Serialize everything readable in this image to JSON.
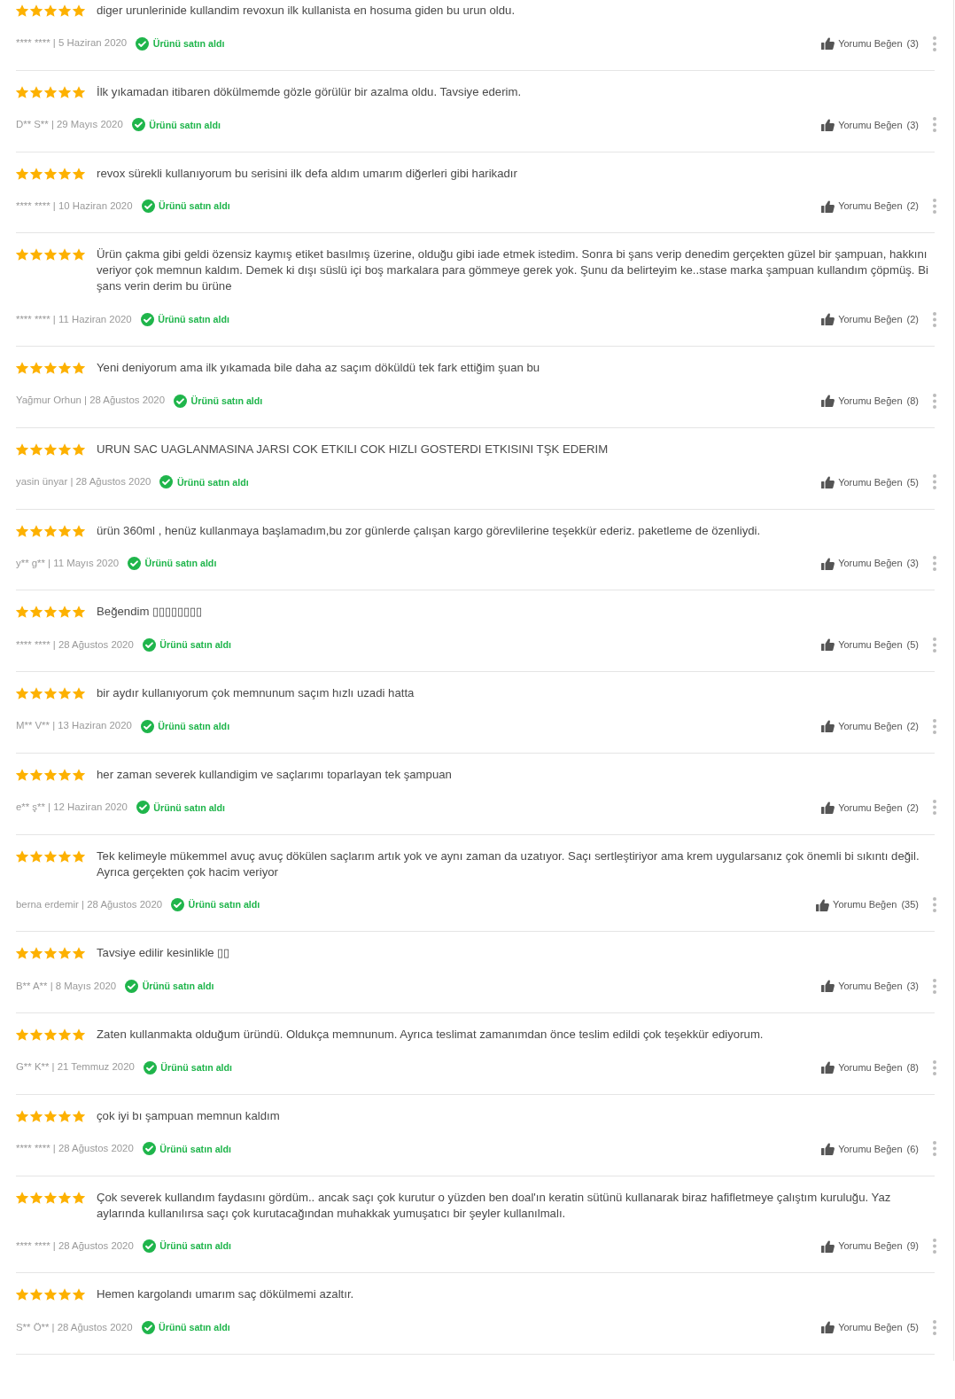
{
  "reviews": [
    {
      "stars": 5,
      "text": "diger urunlerinide kullandim revoxun ilk kullanista en hosuma giden bu urun oldu.",
      "byline": "**** **** | 5 Haziran 2020",
      "verified": true,
      "verified_label": "Ürünü satın aldı",
      "like_label": "Yorumu Beğen",
      "like_count": "(3)"
    },
    {
      "stars": 5,
      "text": "İlk yıkamadan itibaren dökülmemde gözle görülür bir azalma oldu. Tavsiye ederim.",
      "byline": "D** S** | 29 Mayıs 2020",
      "verified": true,
      "verified_label": "Ürünü satın aldı",
      "like_label": "Yorumu Beğen",
      "like_count": "(3)"
    },
    {
      "stars": 5,
      "text": "revox sürekli kullanıyorum bu serisini ilk defa aldım umarım diğerleri gibi harikadır",
      "byline": "**** **** | 10 Haziran 2020",
      "verified": true,
      "verified_label": "Ürünü satın aldı",
      "like_label": "Yorumu Beğen",
      "like_count": "(2)"
    },
    {
      "stars": 5,
      "text": "Ürün çakma gibi geldi özensiz kaymış etiket basılmış üzerine, olduğu gibi iade etmek istedim. Sonra bi şans verip denedim gerçekten güzel bir şampuan, hakkını veriyor çok memnun kaldım. Demek ki dışı süslü içi boş markalara para gömmeye gerek yok. Şunu da belirteyim ke..stase marka şampuan kullandım çöpmüş. Bi şans verin derim bu ürüne",
      "byline": "**** **** | 11 Haziran 2020",
      "verified": true,
      "verified_label": "Ürünü satın aldı",
      "like_label": "Yorumu Beğen",
      "like_count": "(2)"
    },
    {
      "stars": 5,
      "text": "Yeni deniyorum ama ilk yıkamada bile daha az saçım döküldü tek fark ettiğim şuan bu",
      "byline": "Yağmur Orhun | 28 Ağustos 2020",
      "verified": true,
      "verified_label": "Ürünü satın aldı",
      "like_label": "Yorumu Beğen",
      "like_count": "(8)"
    },
    {
      "stars": 5,
      "text": "URUN SAC UAGLANMASINA JARSI COK ETKILI COK HIZLI GOSTERDI ETKISINI TŞK EDERIM",
      "byline": "yasin ünyar | 28 Ağustos 2020",
      "verified": true,
      "verified_label": "Ürünü satın aldı",
      "like_label": "Yorumu Beğen",
      "like_count": "(5)"
    },
    {
      "stars": 5,
      "text": "ürün 360ml , henüz kullanmaya başlamadım,bu zor günlerde çalışan kargo görevlilerine teşekkür ederiz. paketleme de özenliydi.",
      "byline": "y** g** | 11 Mayıs 2020",
      "verified": true,
      "verified_label": "Ürünü satın aldı",
      "like_label": "Yorumu Beğen",
      "like_count": "(3)"
    },
    {
      "stars": 5,
      "text": "Beğendim ▯▯▯▯▯▯▯▯",
      "byline": "**** **** | 28 Ağustos 2020",
      "verified": true,
      "verified_label": "Ürünü satın aldı",
      "like_label": "Yorumu Beğen",
      "like_count": "(5)"
    },
    {
      "stars": 5,
      "text": "bir aydır kullanıyorum çok memnunum saçım hızlı uzadi hatta",
      "byline": "M** V** | 13 Haziran 2020",
      "verified": true,
      "verified_label": "Ürünü satın aldı",
      "like_label": "Yorumu Beğen",
      "like_count": "(2)"
    },
    {
      "stars": 5,
      "text": "her zaman severek kullandigim ve saçlarımı toparlayan tek şampuan",
      "byline": "e** ş** | 12 Haziran 2020",
      "verified": true,
      "verified_label": "Ürünü satın aldı",
      "like_label": "Yorumu Beğen",
      "like_count": "(2)"
    },
    {
      "stars": 5,
      "text": "Tek kelimeyle mükemmel avuç avuç dökülen saçlarım artık yok ve aynı zaman da uzatıyor. Saçı sertleştiriyor ama krem uygularsanız çok önemli bi sıkıntı değil. Ayrıca gerçekten çok hacim veriyor",
      "byline": "berna erdemir | 28 Ağustos 2020",
      "verified": true,
      "verified_label": "Ürünü satın aldı",
      "like_label": "Yorumu Beğen",
      "like_count": "(35)"
    },
    {
      "stars": 5,
      "text": "Tavsiye edilir kesinlikle ▯▯",
      "byline": "B** A** | 8 Mayıs 2020",
      "verified": true,
      "verified_label": "Ürünü satın aldı",
      "like_label": "Yorumu Beğen",
      "like_count": "(3)"
    },
    {
      "stars": 5,
      "text": "Zaten kullanmakta olduğum üründü. Oldukça memnunum. Ayrıca teslimat zamanımdan önce teslim edildi çok teşekkür ediyorum.",
      "byline": "G** K** | 21 Temmuz 2020",
      "verified": true,
      "verified_label": "Ürünü satın aldı",
      "like_label": "Yorumu Beğen",
      "like_count": "(8)"
    },
    {
      "stars": 5,
      "text": "çok iyi bı şampuan memnun kaldım",
      "byline": "**** **** | 28 Ağustos 2020",
      "verified": true,
      "verified_label": "Ürünü satın aldı",
      "like_label": "Yorumu Beğen",
      "like_count": "(6)"
    },
    {
      "stars": 5,
      "text": "Çok severek kullandım faydasını gördüm.. ancak saçı çok kurutur o yüzden ben doal'ın keratin sütünü kullanarak biraz hafifletmeye çalıştım kuruluğu. Yaz aylarında kullanılırsa saçı çok kurutacağından muhakkak yumuşatıcı bir şeyler kullanılmalı.",
      "byline": "**** **** | 28 Ağustos 2020",
      "verified": true,
      "verified_label": "Ürünü satın aldı",
      "like_label": "Yorumu Beğen",
      "like_count": "(9)"
    },
    {
      "stars": 5,
      "text": "Hemen kargolandı umarım saç dökülmemi azaltır.",
      "byline": "S** Ö** | 28 Ağustos 2020",
      "verified": true,
      "verified_label": "Ürünü satın aldı",
      "like_label": "Yorumu Beğen",
      "like_count": "(5)"
    }
  ]
}
